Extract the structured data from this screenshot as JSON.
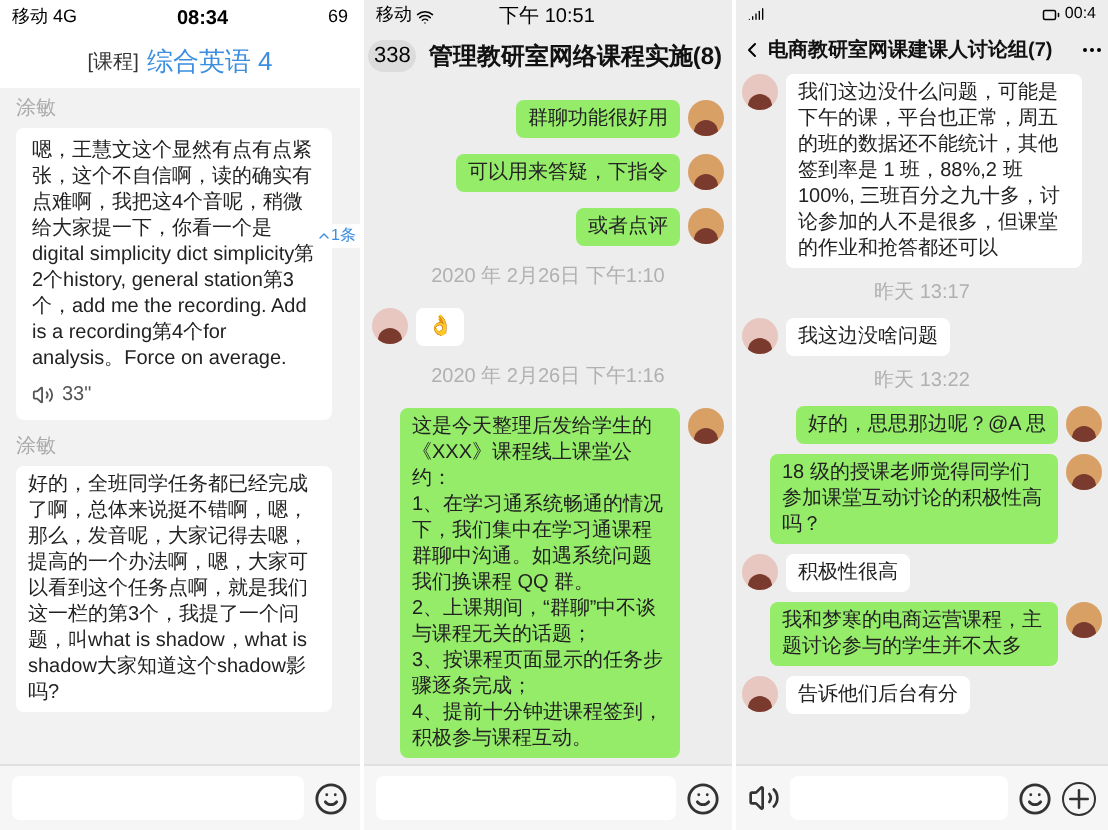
{
  "panels": [
    {
      "status_bar": {
        "carrier": "移动 4G",
        "time": "08:34",
        "battery": "69"
      },
      "title_prefix": "[课程]",
      "title": "综合英语 4",
      "new_badge": "1条",
      "messages": [
        {
          "kind": "voice_text",
          "sender": "涂敏",
          "text": "嗯，王慧文这个显然有点有点紧张，这个不自信啊，读的确实有点难啊，我把这4个音呢，稍微给大家提一下，你看一个是digital simplicity dict simplicity第2个history, general station第3个，add me the recording. Add is a recording第4个for analysis。Force on average.",
          "duration": "33\""
        },
        {
          "kind": "named",
          "sender": "涂敏",
          "text": "好的，全班同学任务都已经完成了啊，总体来说挺不错啊，嗯，那么，发音呢，大家记得去嗯，提高的一个办法啊，嗯，大家可以看到这个任务点啊，就是我们这一栏的第3个，我提了一个问题，叫what is shadow，what is shadow大家知道这个shadow影吗?"
        }
      ]
    },
    {
      "status_bar": {
        "carrier": "移动",
        "time": "下午 10:51"
      },
      "back_count": "338",
      "title": "管理教研室网络课程实施(8)",
      "messages": [
        {
          "kind": "sent",
          "text": "群聊功能很好用"
        },
        {
          "kind": "sent",
          "text": "可以用来答疑，下指令"
        },
        {
          "kind": "sent",
          "text": "或者点评"
        },
        {
          "kind": "time",
          "text": "2020 年 2月26日 下午1:10"
        },
        {
          "kind": "received",
          "text": "👌"
        },
        {
          "kind": "time",
          "text": "2020 年 2月26日 下午1:16"
        },
        {
          "kind": "sent",
          "text": "这是今天整理后发给学生的《XXX》课程线上课堂公约：\n1、在学习通系统畅通的情况下，我们集中在学习通课程群聊中沟通。如遇系统问题我们换课程 QQ 群。\n2、上课期间，“群聊”中不谈与课程无关的话题；\n3、按课程页面显示的任务步骤逐条完成；\n4、提前十分钟进课程签到，积极参与课程互动。"
        }
      ]
    },
    {
      "status_bar": {
        "time": "00:4"
      },
      "title": "电商教研室网课建课人讨论组(7)",
      "messages": [
        {
          "kind": "received",
          "text": "我们这边没什么问题，可能是下午的课，平台也正常，周五的班的数据还不能统计，其他签到率是 1 班，88%,2 班 100%, 三班百分之九十多，讨论参加的人不是很多，但课堂的作业和抢答都还可以"
        },
        {
          "kind": "time",
          "text": "昨天 13:17"
        },
        {
          "kind": "received",
          "text": "我这边没啥问题"
        },
        {
          "kind": "time",
          "text": "昨天 13:22"
        },
        {
          "kind": "sent",
          "text": "好的，思思那边呢？@A 思"
        },
        {
          "kind": "sent",
          "text": "18 级的授课老师觉得同学们参加课堂互动讨论的积极性高吗？"
        },
        {
          "kind": "received",
          "text": "积极性很高"
        },
        {
          "kind": "sent",
          "text": "我和梦寒的电商运营课程，主题讨论参与的学生并不太多"
        },
        {
          "kind": "received",
          "text": "告诉他们后台有分"
        }
      ]
    }
  ]
}
